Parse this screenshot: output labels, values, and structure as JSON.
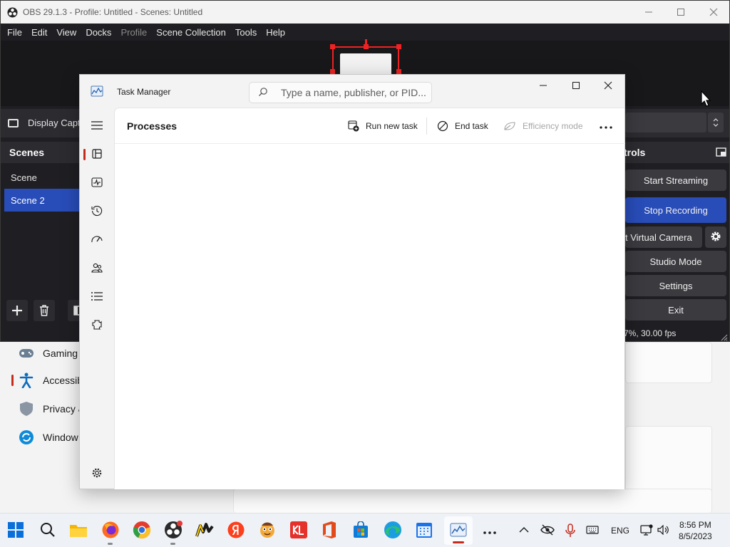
{
  "obs": {
    "title": "OBS 29.1.3 - Profile: Untitled - Scenes: Untitled",
    "menu": [
      "File",
      "Edit",
      "View",
      "Docks",
      "Profile",
      "Scene Collection",
      "Tools",
      "Help"
    ],
    "menu_disabled": [
      "Profile"
    ],
    "source_label": "Display Capt",
    "scenes_title": "Scenes",
    "scenes": [
      "Scene",
      "Scene 2"
    ],
    "selected_scene": "Scene 2",
    "controls_title": "trols",
    "controls": {
      "start_streaming": "Start Streaming",
      "stop_recording": "Stop Recording",
      "virtual_camera": "t Virtual Camera",
      "studio_mode": "Studio Mode",
      "settings": "Settings",
      "exit": "Exit"
    },
    "status": "7%, 30.00 fps"
  },
  "settings_bg": {
    "items": [
      "Gaming",
      "Accessib",
      "Privacy &",
      "Window"
    ]
  },
  "task_manager": {
    "title": "Task Manager",
    "search_placeholder": "Type a name, publisher, or PID...",
    "page_title": "Processes",
    "commands": {
      "run_new_task": "Run new task",
      "end_task": "End task",
      "efficiency_mode": "Efficiency mode"
    }
  },
  "taskbar": {
    "language": "ENG",
    "time": "8:56 PM",
    "date": "8/5/2023"
  },
  "colors": {
    "accent_red": "#c42b1c",
    "obs_blue": "#284cb8",
    "obs_dark": "#1f1f23"
  }
}
